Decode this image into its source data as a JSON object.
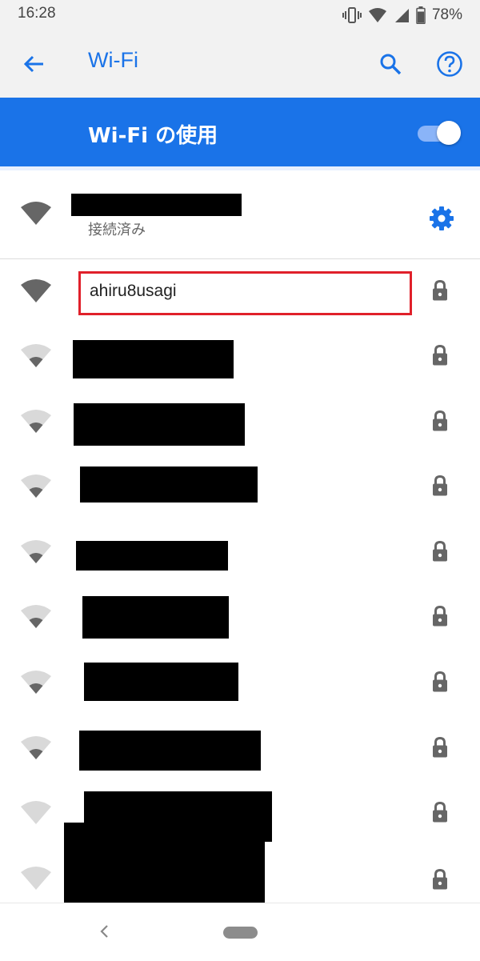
{
  "status_bar": {
    "time": "16:28",
    "battery_percent": "78%",
    "icons": [
      "vibrate-icon",
      "wifi-signal-icon",
      "cell-signal-icon",
      "battery-icon"
    ]
  },
  "app_bar": {
    "title": "Wi-Fi",
    "back_icon": "arrow-back-icon",
    "search_icon": "search-icon",
    "help_icon": "help-icon"
  },
  "wifi_toggle": {
    "label": "Wi-Fi の使用",
    "enabled": true
  },
  "connected_network": {
    "name_redacted": true,
    "status": "接続済み",
    "settings_icon": "gear-icon"
  },
  "networks": [
    {
      "ssid": "ahiru8usagi",
      "highlighted": true,
      "signal": "full",
      "secured": true
    },
    {
      "ssid": "",
      "redacted": true,
      "signal": "low",
      "secured": true
    },
    {
      "ssid": "",
      "redacted": true,
      "signal": "low",
      "secured": true
    },
    {
      "ssid": "",
      "redacted": true,
      "signal": "low",
      "secured": true
    },
    {
      "ssid": "",
      "redacted": true,
      "signal": "low",
      "secured": true
    },
    {
      "ssid": "",
      "redacted": true,
      "signal": "low",
      "secured": true
    },
    {
      "ssid": "",
      "redacted": true,
      "signal": "low",
      "secured": true
    },
    {
      "ssid": "",
      "redacted": true,
      "signal": "low",
      "secured": true
    },
    {
      "ssid": "",
      "redacted": true,
      "signal": "none",
      "secured": true
    },
    {
      "ssid": "",
      "redacted": true,
      "signal": "none",
      "secured": true
    }
  ],
  "colors": {
    "accent": "#1a73e8",
    "highlight_border": "#e0202a",
    "toolbar_bg": "#f2f2f2"
  },
  "nav_bar": {
    "back_icon": "chevron-left-icon",
    "home_icon": "home-pill-icon"
  }
}
